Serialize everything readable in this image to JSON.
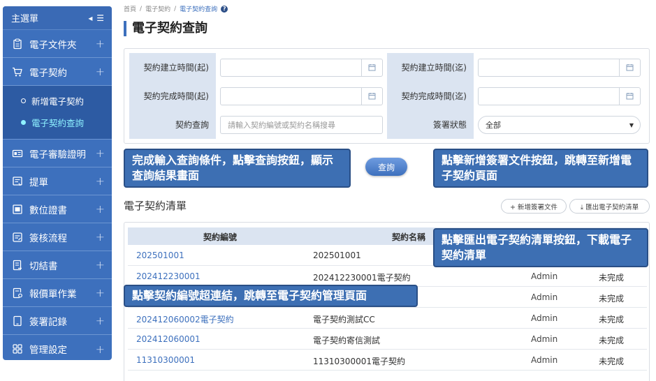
{
  "sidebar": {
    "title": "主選單",
    "collapse_icon": "◂ ☰",
    "items": [
      {
        "label": "電子文件夾",
        "icon": "clipboard-icon"
      },
      {
        "label": "電子契約",
        "icon": "cart-icon"
      },
      {
        "label": "電子審驗證明",
        "icon": "id-card-icon"
      },
      {
        "label": "提單",
        "icon": "receipt-icon"
      },
      {
        "label": "數位證書",
        "icon": "certificate-icon"
      },
      {
        "label": "簽核流程",
        "icon": "flow-icon"
      },
      {
        "label": "切結書",
        "icon": "document-icon"
      },
      {
        "label": "報價單作業",
        "icon": "quote-icon"
      },
      {
        "label": "簽署記錄",
        "icon": "tablet-icon"
      },
      {
        "label": "管理設定",
        "icon": "grid-icon"
      }
    ],
    "submenu": [
      {
        "label": "新增電子契約",
        "active": false
      },
      {
        "label": "電子契約查詢",
        "active": true
      }
    ],
    "plus": "+"
  },
  "breadcrumb": {
    "home": "首頁",
    "sep": "/",
    "level1": "電子契約",
    "current": "電子契約查詢",
    "help": "?"
  },
  "page_title": "電子契約查詢",
  "filter": {
    "create_start_label": "契約建立時間(起)",
    "create_end_label": "契約建立時間(迄)",
    "complete_start_label": "契約完成時間(起)",
    "complete_end_label": "契約完成時間(迄)",
    "search_label": "契約查詢",
    "search_placeholder": "請輸入契約編號或契約名稱搜尋",
    "status_label": "簽署狀態",
    "status_value": "全部",
    "status_arrow": "▼"
  },
  "query_button": "查詢",
  "callouts": {
    "query": "完成輸入查詢條件，點擊查詢按鈕，顯示查詢結果畫面",
    "add": "點擊新增簽署文件按鈕，跳轉至新增電子契約頁面",
    "export": "點擊匯出電子契約清單按鈕，下載電子契約清單",
    "link": "點擊契約編號超連結，跳轉至電子契約管理頁面"
  },
  "list": {
    "title": "電子契約清單",
    "add_button": "+ 新增簽署文件",
    "export_button": "⤓ 匯出電子契約清單",
    "columns": [
      "契約編號",
      "契約名稱"
    ],
    "rows": [
      {
        "id": "202501001",
        "name": "202501001",
        "owner": "",
        "status": ""
      },
      {
        "id": "202412230001",
        "name": "202412230001電子契約",
        "owner": "Admin",
        "status": "未完成"
      },
      {
        "id": "",
        "name": "",
        "owner": "Admin",
        "status": "未完成"
      },
      {
        "id": "202412060002電子契約",
        "name": "電子契約測試CC",
        "owner": "Admin",
        "status": "未完成"
      },
      {
        "id": "202412060001",
        "name": "電子契約寄信測試",
        "owner": "Admin",
        "status": "未完成"
      },
      {
        "id": "11310300001",
        "name": "11310300001電子契約",
        "owner": "Admin",
        "status": "未完成"
      }
    ]
  },
  "colors": {
    "primary": "#3d70bd",
    "sidebar": "#3d70bd",
    "header_bg": "#dbe4f1",
    "active_sub": "#8ff2ff",
    "callout": "#3d6fb3"
  }
}
